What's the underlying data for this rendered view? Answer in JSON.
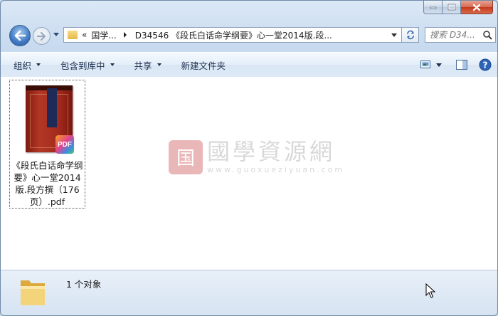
{
  "window": {
    "caption_buttons": [
      "minimize",
      "maximize",
      "close"
    ]
  },
  "nav": {
    "breadcrumb_prefix": "«",
    "breadcrumbs": [
      "国学...",
      "D34546 《段氏白话命学纲要》心一堂2014版.段..."
    ],
    "search_placeholder": "搜索 D34..."
  },
  "toolbar": {
    "items": [
      {
        "label": "组织",
        "dropdown": true
      },
      {
        "label": "包含到库中",
        "dropdown": true
      },
      {
        "label": "共享",
        "dropdown": true
      },
      {
        "label": "新建文件夹",
        "dropdown": false
      }
    ]
  },
  "content": {
    "file": {
      "name": "《段氏白话命学纲要》心一堂2014版.段方撰（176页）.pdf",
      "badge": "PDF"
    },
    "watermark": {
      "seal": "国",
      "text": "國學資源網",
      "url": "www.guoxueziyuan.com"
    }
  },
  "status": {
    "text": "1 个对象"
  },
  "colors": {
    "accent": "#3f78c2",
    "close": "#c4391c",
    "watermark": "#c1272d"
  }
}
